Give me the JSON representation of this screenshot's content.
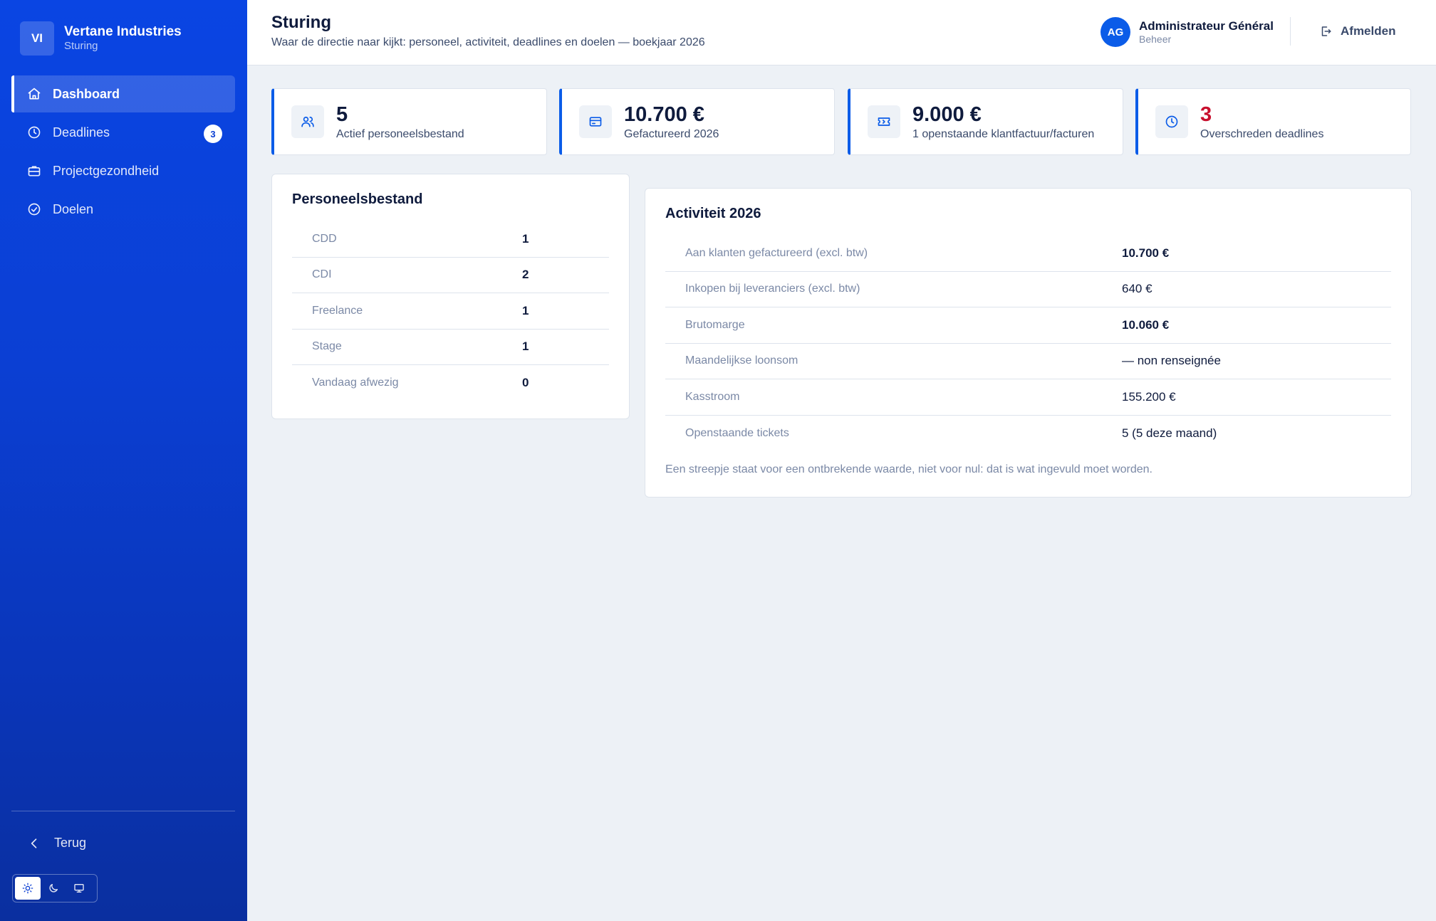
{
  "brand": {
    "initials": "VI",
    "name": "Vertane Industries",
    "subtitle": "Sturing"
  },
  "sidebar": {
    "items": [
      {
        "label": "Dashboard",
        "icon": "home-icon",
        "active": true
      },
      {
        "label": "Deadlines",
        "icon": "clock-icon",
        "badge": "3"
      },
      {
        "label": "Projectgezondheid",
        "icon": "briefcase-icon"
      },
      {
        "label": "Doelen",
        "icon": "check-circle-icon"
      }
    ],
    "back_label": "Terug",
    "theme": {
      "active": "light",
      "options": [
        "sun-icon",
        "moon-icon",
        "monitor-icon"
      ]
    }
  },
  "header": {
    "title": "Sturing",
    "subtitle": "Waar de directie naar kijkt: personeel, activiteit, deadlines en doelen — boekjaar 2026",
    "user": {
      "initials": "AG",
      "name": "Administrateur Général",
      "role": "Beheer"
    },
    "logout_label": "Afmelden"
  },
  "stats": [
    {
      "value": "5",
      "label": "Actief personeelsbestand",
      "icon": "users-icon"
    },
    {
      "value": "10.700 €",
      "label": "Gefactureerd 2026",
      "icon": "credit-card-icon"
    },
    {
      "value": "9.000 €",
      "label": "1 openstaande klantfactuur/facturen",
      "icon": "ticket-icon"
    },
    {
      "value": "3",
      "label": "Overschreden deadlines",
      "icon": "clock-icon",
      "alert": true
    }
  ],
  "personnel": {
    "title": "Personeelsbestand",
    "rows": [
      {
        "label": "CDD",
        "value": "1"
      },
      {
        "label": "CDI",
        "value": "2"
      },
      {
        "label": "Freelance",
        "value": "1"
      },
      {
        "label": "Stage",
        "value": "1"
      },
      {
        "label": "Vandaag afwezig",
        "value": "0"
      }
    ]
  },
  "activity": {
    "title": "Activiteit 2026",
    "rows": [
      {
        "label": "Aan klanten gefactureerd (excl. btw)",
        "value": "10.700 €",
        "bold": true
      },
      {
        "label": "Inkopen bij leveranciers (excl. btw)",
        "value": "640 €"
      },
      {
        "label": "Brutomarge",
        "value": "10.060 €",
        "bold": true
      },
      {
        "label": "Maandelijkse loonsom",
        "value": "— non renseignée"
      },
      {
        "label": "Kasstroom",
        "value": "155.200 €"
      },
      {
        "label": "Openstaande tickets",
        "value": "5 (5 deze maand)"
      }
    ],
    "note": "Een streepje staat voor een ontbrekende waarde, niet voor nul: dat is wat ingevuld moet worden."
  },
  "colors": {
    "accent": "#0b5ce8",
    "sidebar": "#0b3fd3",
    "danger": "#c8102e"
  }
}
